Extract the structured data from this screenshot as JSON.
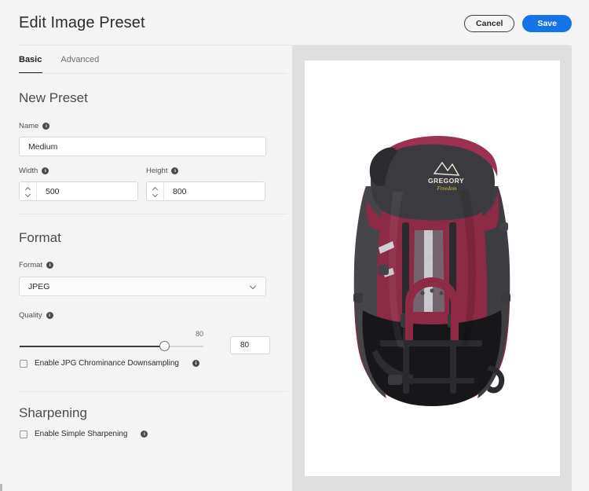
{
  "header": {
    "title": "Edit Image Preset",
    "cancel_label": "Cancel",
    "save_label": "Save",
    "accent_color": "#1473e6"
  },
  "tabs": [
    {
      "label": "Basic",
      "active": true
    },
    {
      "label": "Advanced",
      "active": false
    }
  ],
  "sections": {
    "new_preset": {
      "title": "New Preset",
      "name": {
        "label": "Name",
        "value": "Medium",
        "info": "i"
      },
      "width": {
        "label": "Width",
        "value": "500",
        "info": "i"
      },
      "height": {
        "label": "Height",
        "value": "800",
        "info": "i"
      }
    },
    "format": {
      "title": "Format",
      "format": {
        "label": "Format",
        "value": "JPEG",
        "info": "i"
      },
      "quality": {
        "label": "Quality",
        "info": "i",
        "slider_value": "80",
        "input_value": "80",
        "min": 0,
        "max": 100,
        "fill_percent": 80
      },
      "chrominance": {
        "label": "Enable JPG Chrominance Downsampling",
        "checked": false,
        "info": "i"
      }
    },
    "sharpening": {
      "title": "Sharpening",
      "simple_sharpening": {
        "label": "Enable Simple Sharpening",
        "checked": false,
        "info": "i"
      }
    }
  },
  "preview": {
    "background_color": "#dfdfdf",
    "canvas_color": "#ffffff",
    "image_alt": "Gregory backpack product photo",
    "brand_text": "GREGORY",
    "model_text": "Freedom",
    "colors": {
      "burgundy": "#8d2a46",
      "burgundy_dark": "#6e1f36",
      "burgundy_light": "#a8395a",
      "charcoal": "#3b3b3f",
      "charcoal_dark": "#2a2a2e",
      "black": "#151517",
      "gray_strap": "#8a8a8f",
      "light_gray": "#d6d6d8"
    }
  }
}
